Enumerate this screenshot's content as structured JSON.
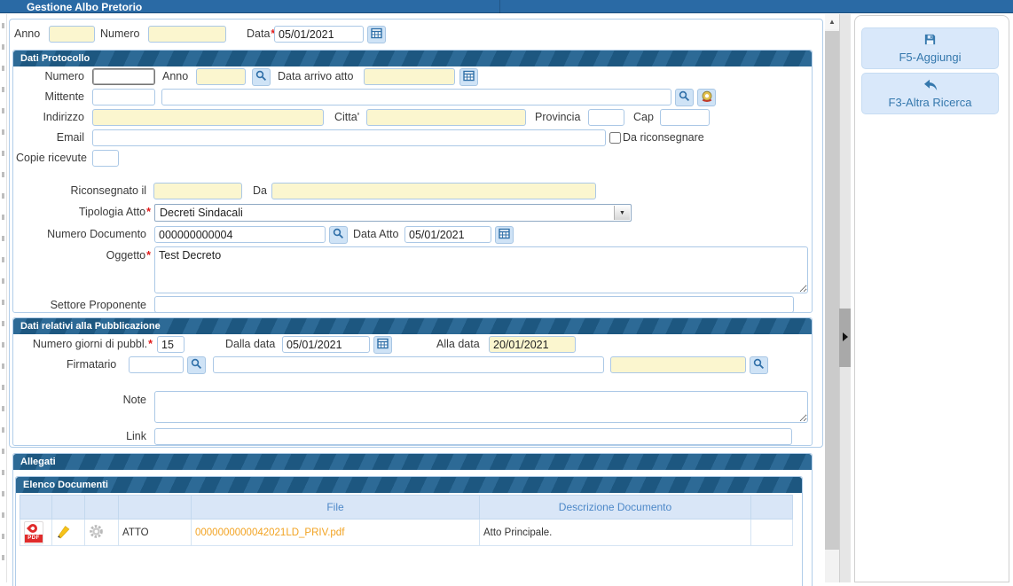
{
  "ui": {
    "required_marker": "*",
    "scroll_up_glyph": "▲",
    "select_arrow_glyph": "▼",
    "pdf_badge": "PDF"
  },
  "window": {
    "title": "Gestione Albo Pretorio"
  },
  "search_form": {
    "anno_label": "Anno",
    "anno_value": "",
    "numero_label": "Numero",
    "numero_value": "",
    "data_label": "Data",
    "data_value": "05/01/2021"
  },
  "protocollo": {
    "title": "Dati Protocollo",
    "numero_label": "Numero",
    "numero_value": "",
    "anno_label": "Anno",
    "anno_value": "",
    "data_arrivo_label": "Data arrivo atto",
    "data_arrivo_value": "",
    "mittente_label": "Mittente",
    "mittente_code": "",
    "mittente_name": "",
    "indirizzo_label": "Indirizzo",
    "indirizzo_value": "",
    "citta_label": "Citta'",
    "citta_value": "",
    "provincia_label": "Provincia",
    "provincia_value": "",
    "cap_label": "Cap",
    "cap_value": "",
    "email_label": "Email",
    "email_value": "",
    "da_riconsegnare_label": "Da riconsegnare",
    "copie_label": "Copie ricevute",
    "copie_value": "",
    "riconsegnato_label": "Riconsegnato il",
    "riconsegnato_value": "",
    "da_label": "Da",
    "da_value": "",
    "tipologia_label": "Tipologia Atto",
    "tipologia_value": "Decreti Sindacali",
    "numero_documento_label": "Numero Documento",
    "numero_documento_value": "000000000004",
    "data_atto_label": "Data Atto",
    "data_atto_value": "05/01/2021",
    "oggetto_label": "Oggetto",
    "oggetto_value": "Test Decreto",
    "settore_label": "Settore Proponente",
    "settore_value": ""
  },
  "pubblicazione": {
    "title": "Dati relativi alla Pubblicazione",
    "giorni_label": "Numero giorni di pubbl.",
    "giorni_value": "15",
    "dalla_label": "Dalla data",
    "dalla_value": "05/01/2021",
    "alla_label": "Alla data",
    "alla_value": "20/01/2021",
    "firmatario_label": "Firmatario",
    "firmatario_code": "",
    "firmatario_name": "",
    "firmatario_extra": "",
    "note_label": "Note",
    "note_value": "",
    "link_label": "Link",
    "link_value": ""
  },
  "allegati": {
    "title": "Allegati",
    "elenco_title": "Elenco Documenti",
    "col_file": "File",
    "col_descrizione": "Descrizione Documento",
    "rows": [
      {
        "tipo": "ATTO",
        "file": "0000000000042021LD_PRIV.pdf",
        "descrizione": "Atto Principale."
      }
    ]
  },
  "actions": {
    "aggiungi": "F5-Aggiungi",
    "altra_ricerca": "F3-Altra Ricerca"
  },
  "colors": {
    "accent": "#2a6aa5",
    "section_header": "#20618f",
    "input_yellow": "#fbf6cf",
    "link_orange": "#f2a322",
    "button_bg": "#d9e8fa"
  }
}
